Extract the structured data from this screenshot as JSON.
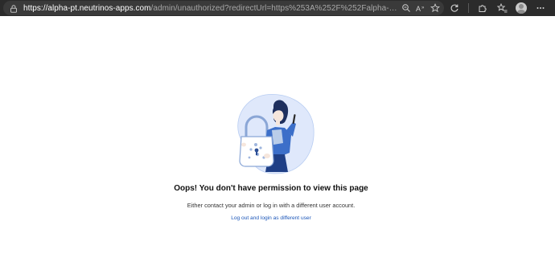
{
  "browser": {
    "url_host": "https://alpha-pt.neutrinos-apps.com",
    "url_rest": "/admin/unauthorized?redirectUrl=https%253A%252F%252Falpha-pt.neutrinos-apps.com%252Fadm...",
    "address_icons": [
      "zoom-icon",
      "read-aloud-icon",
      "favorite-star-icon"
    ],
    "toolbar_icons": [
      "refresh-icon",
      "extensions-icon",
      "favorites-icon",
      "profile-avatar",
      "more-icon"
    ]
  },
  "page": {
    "title": "Oops! You don't have permission to view this page",
    "message": "Either contact your admin or log in with a different user account.",
    "link_label": "Log out and login as different user"
  },
  "colors": {
    "browser_bar": "#2b2b2b",
    "link": "#1a55b8",
    "illustration_blue": "#3c6fc9",
    "illustration_bg": "#dfe8fb"
  }
}
